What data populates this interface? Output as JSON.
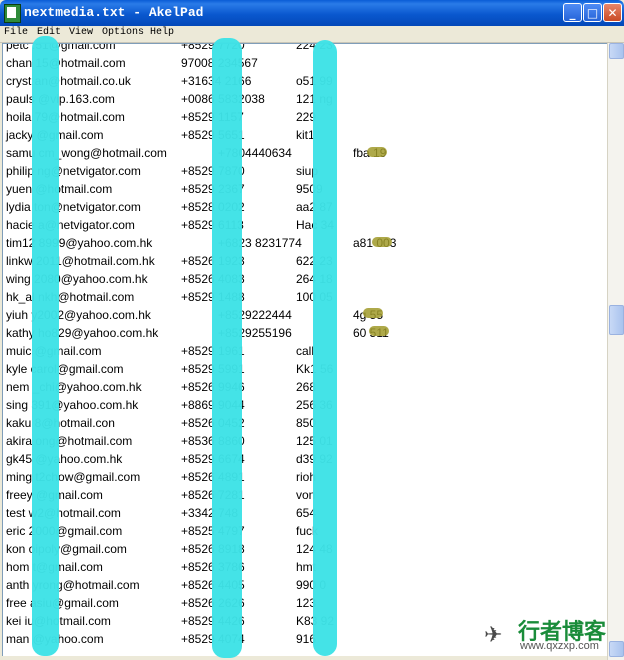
{
  "window": {
    "title": "nextmedia.txt - AkelPad"
  },
  "menu": [
    "File",
    "Edit",
    "View",
    "Options",
    "Help"
  ],
  "rows": [
    {
      "email": "petc      .51@gmail.com",
      "phone": "+8529       7720",
      "extra": "224     23"
    },
    {
      "email": "chan    15@hotmail.com",
      "phone": "97008      234567",
      "extra": ""
    },
    {
      "email": "cryst      an@hotmail.co.uk",
      "phone": "+31634      2166",
      "extra": "o51     99"
    },
    {
      "email": "pauls      @vip.163.com",
      "phone": "+0086      5832038",
      "extra": "121      ng"
    },
    {
      "email": "hoila      79@hotmail.com",
      "phone": "+8529      1157",
      "extra": "229"
    },
    {
      "email": "jacky      @gmail.com",
      "phone": "+8529      5651",
      "extra": "kit1"
    },
    {
      "email": "samu      cm_wong@hotmail.com",
      "phone": "+7804440634",
      "extra": "fba     19",
      "shift": true
    },
    {
      "email": "philip      ng@netvigator.com",
      "phone": "+8529      7870",
      "extra": "siup"
    },
    {
      "email": "yuen      @hotmail.com",
      "phone": "+8529      2367",
      "extra": "9509"
    },
    {
      "email": "lydia      ton@netvigator.com",
      "phone": "+8528      0202",
      "extra": "aa2      87"
    },
    {
      "email": "hacie      a@netvigator.com",
      "phone": "+8529      6113",
      "extra": "Hac      34"
    },
    {
      "email": "tim12      8999@yahoo.com.hk",
      "phone": "+6823      8231774",
      "extra": "a81     003",
      "shift": true
    },
    {
      "email": "linkw      2011@hotmail.com.hk",
      "phone": "+8526      1923",
      "extra": "622      23"
    },
    {
      "email": "wing      2080@yahoo.com.hk",
      "phone": "+8526      4083",
      "extra": "264      18"
    },
    {
      "email": "hk_al      nkh@hotmail.com",
      "phone": "+8529      1488",
      "extra": "100      05"
    },
    {
      "email": "yiuh      y2002@yahoo.com.hk",
      "phone": "+8529222444",
      "extra": "4g     55",
      "shift": true
    },
    {
      "email": "kathy      ho829@yahoo.com.hk",
      "phone": "+8529255196",
      "extra": "60     511",
      "shift": true
    },
    {
      "email": "muic      @gmail.com",
      "phone": "+8529      1961",
      "extra": "call"
    },
    {
      "email": "kyle      carol@gmail.com",
      "phone": "+8529      5991",
      "extra": "Kk1      56"
    },
    {
      "email": "nem      _chi@yahoo.com.hk",
      "phone": "+8526      9946",
      "extra": "268"
    },
    {
      "email": "sing      391@yahoo.com.hk",
      "phone": "+8869      9044",
      "extra": "256      36"
    },
    {
      "email": "kaku      8@hotmail.con",
      "phone": "+8526      0452",
      "extra": "850"
    },
    {
      "email": "akira      ong@hotmail.com",
      "phone": "+8536      8860",
      "extra": "125      01"
    },
    {
      "email": "gk45      @yahoo.com.hk",
      "phone": "+8529      6674",
      "extra": "d39      92"
    },
    {
      "email": "ming      t2chow@gmail.com",
      "phone": "+8526      4891",
      "extra": "rioh"
    },
    {
      "email": "freey      @gmail.com",
      "phone": "+8526      7281",
      "extra": "von"
    },
    {
      "email": "test      w2@hotmail.com",
      "phone": "+3342      748",
      "extra": "654"
    },
    {
      "email": "eric      2000@gmail.com",
      "phone": "+8525      4797",
      "extra": "fuck"
    },
    {
      "email": "kon      oipoly@gmail.com",
      "phone": "+8526      8918",
      "extra": "124      48"
    },
    {
      "email": "hom      t@gmail.com",
      "phone": "+8526      3786",
      "extra": "hmt"
    },
    {
      "email": "anth      yrong@hotmail.com",
      "phone": "+8526      4405",
      "extra": "990      0"
    },
    {
      "email": "free      asiu@gmail.com",
      "phone": "+8526      2626",
      "extra": "123"
    },
    {
      "email": "kei      iu@hotmail.com",
      "phone": "+8529      4426",
      "extra": "K83      92"
    },
    {
      "email": "man      @yahoo.com",
      "phone": "+8529      4074",
      "extra": "916"
    }
  ],
  "watermark": {
    "text": "行者博客",
    "url": "www.qxzxp.com"
  },
  "colors": {
    "titlebar": "#0a58cf",
    "redaction": "#3ee2e6",
    "watermark_green": "#1a8c3a"
  }
}
